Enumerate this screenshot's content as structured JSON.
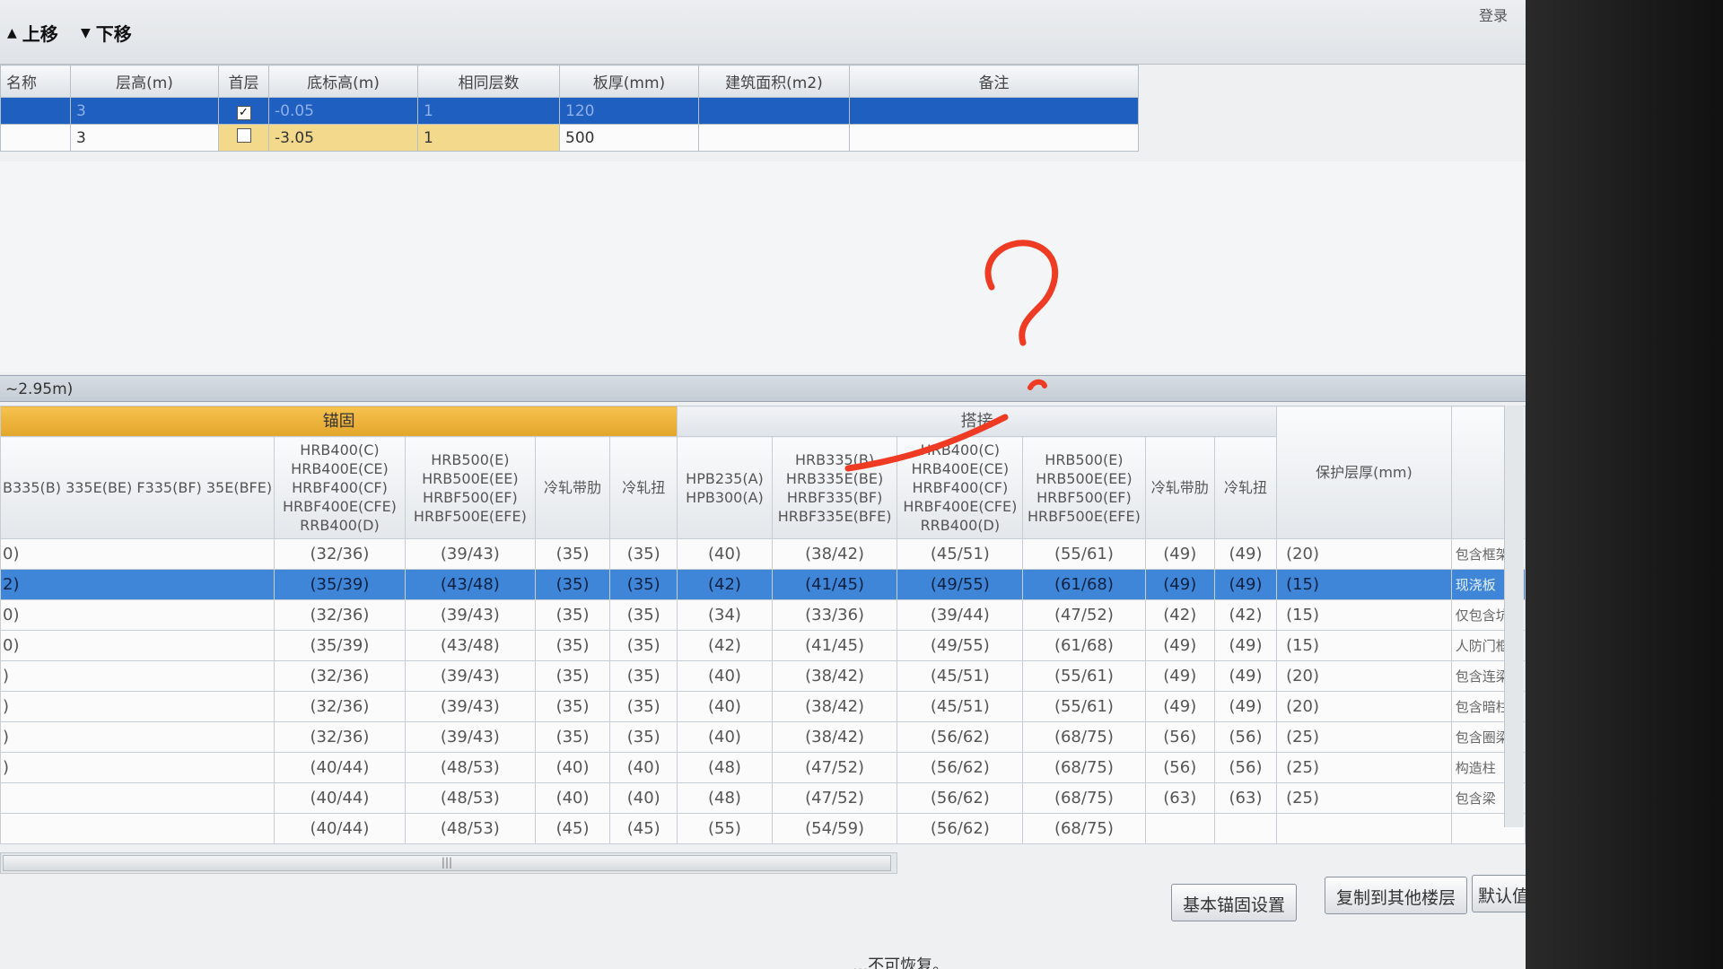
{
  "toolbar": {
    "move_up": "上移",
    "move_down": "下移",
    "right_label": "登录"
  },
  "floor_grid": {
    "headers": [
      "名称",
      "层高(m)",
      "首层",
      "底标高(m)",
      "相同层数",
      "板厚(mm)",
      "建筑面积(m2)",
      "备注"
    ],
    "rows": [
      {
        "name": "",
        "height": "3",
        "first": true,
        "bottom": "-0.05",
        "same": "1",
        "slab": "120",
        "area": "",
        "note": ""
      },
      {
        "name": "",
        "height": "3",
        "first": false,
        "bottom": "-3.05",
        "same": "1",
        "slab": "500",
        "area": "",
        "note": ""
      }
    ]
  },
  "strip": {
    "text": "~2.95m)"
  },
  "rebar": {
    "group_anchor": "锚固",
    "group_lap": "搭接",
    "cover_header": "保护层厚(mm)",
    "anchor_cols": [
      "B335(B) 335E(BE) F335(BF) 35E(BFE)",
      "HRB400(C) HRB400E(CE) HRBF400(CF) HRBF400E(CFE) RRB400(D)",
      "HRB500(E) HRB500E(EE) HRBF500(EF) HRBF500E(EFE)",
      "冷轧带肋",
      "冷轧扭"
    ],
    "lap_cols": [
      "HPB235(A) HPB300(A)",
      "HRB335(B) HRB335E(BE) HRBF335(BF) HRBF335E(BFE)",
      "HRB400(C) HRB400E(CE) HRBF400(CF) HRBF400E(CFE) RRB400(D)",
      "HRB500(E) HRB500E(EE) HRBF500(EF) HRBF500E(EFE)",
      "冷轧带肋",
      "冷轧扭"
    ],
    "rows": [
      {
        "c0": "0)",
        "c1": "(32/36)",
        "c2": "(39/43)",
        "c3": "(35)",
        "c4": "(35)",
        "l0": "(40)",
        "l1": "(38/42)",
        "l2": "(45/51)",
        "l3": "(55/61)",
        "l4": "(49)",
        "l5": "(49)",
        "cover": "(20)",
        "note": "包含框架"
      },
      {
        "c0": "2)",
        "c1": "(35/39)",
        "c2": "(43/48)",
        "c3": "(35)",
        "c4": "(35)",
        "l0": "(42)",
        "l1": "(41/45)",
        "l2": "(49/55)",
        "l3": "(61/68)",
        "l4": "(49)",
        "l5": "(49)",
        "cover": "(15)",
        "note": "现浇板"
      },
      {
        "c0": "0)",
        "c1": "(32/36)",
        "c2": "(39/43)",
        "c3": "(35)",
        "c4": "(35)",
        "l0": "(34)",
        "l1": "(33/36)",
        "l2": "(39/44)",
        "l3": "(47/52)",
        "l4": "(42)",
        "l5": "(42)",
        "cover": "(15)",
        "note": "仅包含坑"
      },
      {
        "c0": "0)",
        "c1": "(35/39)",
        "c2": "(43/48)",
        "c3": "(35)",
        "c4": "(35)",
        "l0": "(42)",
        "l1": "(41/45)",
        "l2": "(49/55)",
        "l3": "(61/68)",
        "l4": "(49)",
        "l5": "(49)",
        "cover": "(15)",
        "note": "人防门框"
      },
      {
        "c0": ")",
        "c1": "(32/36)",
        "c2": "(39/43)",
        "c3": "(35)",
        "c4": "(35)",
        "l0": "(40)",
        "l1": "(38/42)",
        "l2": "(45/51)",
        "l3": "(55/61)",
        "l4": "(49)",
        "l5": "(49)",
        "cover": "(20)",
        "note": "包含连梁"
      },
      {
        "c0": ")",
        "c1": "(32/36)",
        "c2": "(39/43)",
        "c3": "(35)",
        "c4": "(35)",
        "l0": "(40)",
        "l1": "(38/42)",
        "l2": "(45/51)",
        "l3": "(55/61)",
        "l4": "(49)",
        "l5": "(49)",
        "cover": "(20)",
        "note": "包含暗柱"
      },
      {
        "c0": ")",
        "c1": "(32/36)",
        "c2": "(39/43)",
        "c3": "(35)",
        "c4": "(35)",
        "l0": "(40)",
        "l1": "(38/42)",
        "l2": "(56/62)",
        "l3": "(68/75)",
        "l4": "(56)",
        "l5": "(56)",
        "cover": "(25)",
        "note": "包含圈梁"
      },
      {
        "c0": ")",
        "c1": "(40/44)",
        "c2": "(48/53)",
        "c3": "(40)",
        "c4": "(40)",
        "l0": "(48)",
        "l1": "(47/52)",
        "l2": "(56/62)",
        "l3": "(68/75)",
        "l4": "(56)",
        "l5": "(56)",
        "cover": "(25)",
        "note": "构造柱"
      },
      {
        "c0": "",
        "c1": "(40/44)",
        "c2": "(48/53)",
        "c3": "(40)",
        "c4": "(40)",
        "l0": "(48)",
        "l1": "(47/52)",
        "l2": "(56/62)",
        "l3": "(68/75)",
        "l4": "(63)",
        "l5": "(63)",
        "cover": "(25)",
        "note": "包含梁"
      },
      {
        "c0": "",
        "c1": "(40/44)",
        "c2": "(48/53)",
        "c3": "(45)",
        "c4": "(45)",
        "l0": "(55)",
        "l1": "(54/59)",
        "l2": "(56/62)",
        "l3": "(68/75)",
        "l4": "",
        "l5": "",
        "cover": "",
        "note": ""
      }
    ]
  },
  "buttons": {
    "basic_anchor": "基本锚固设置",
    "copy_floors": "复制到其他楼层",
    "default": "默认值(D)"
  },
  "hint": "...不可恢复。",
  "annotation": {
    "symbol": "?",
    "color": "#ef3b24"
  },
  "colors": {
    "selected_row": "#3f86d8",
    "anchor_group": "#e8aa30",
    "floor_selected": "#1f5fbf"
  }
}
